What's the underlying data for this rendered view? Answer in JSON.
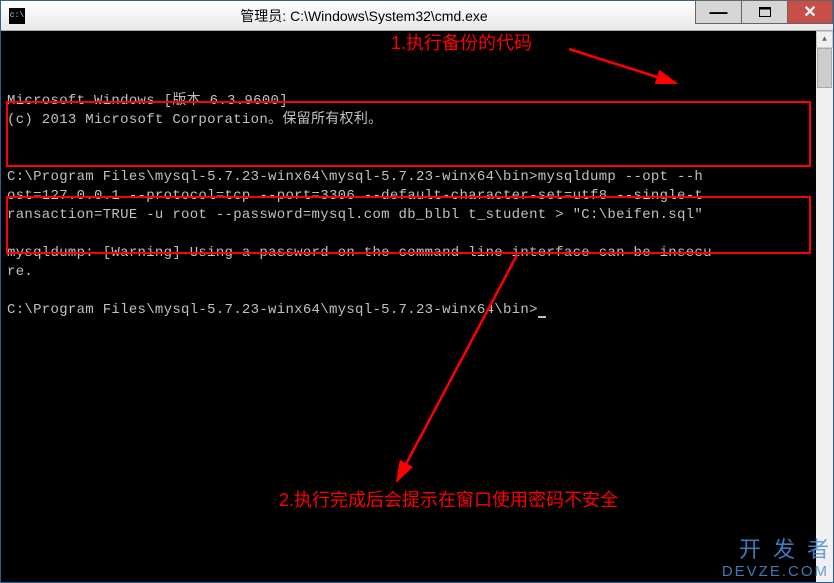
{
  "window": {
    "title": "管理员: C:\\Windows\\System32\\cmd.exe",
    "icon_name": "cmd-icon",
    "icon_glyph": "c:\\"
  },
  "terminal": {
    "line1": "Microsoft Windows [版本 6.3.9600]",
    "line2": "(c) 2013 Microsoft Corporation。保留所有权利。",
    "blank1": "",
    "prompt1_path": "C:\\Program Files\\mysql-5.7.23-winx64\\mysql-5.7.23-winx64\\bin>",
    "cmd_part1": "mysqldump --opt --h",
    "cmd_line2": "ost=127.0.0.1 --protocol=tcp --port=3306 --default-character-set=utf8 --single-t",
    "cmd_line3": "ransaction=TRUE -u root --password=mysql.com db_blbl t_student > \"C:\\beifen.sql\"",
    "blank2": "",
    "warning_line1": "mysqldump: [Warning] Using a password on the command line interface can be insecu",
    "warning_line2": "re.",
    "blank3": "",
    "prompt2_path": "C:\\Program Files\\mysql-5.7.23-winx64\\mysql-5.7.23-winx64\\bin>"
  },
  "annotations": {
    "label1": "1.执行备份的代码",
    "label2": "2.执行完成后会提示在窗口使用密码不安全"
  },
  "watermark": {
    "cn": "开发者",
    "en": "DEVZE.COM"
  },
  "controls": {
    "minimize": "—",
    "close": "✕"
  }
}
